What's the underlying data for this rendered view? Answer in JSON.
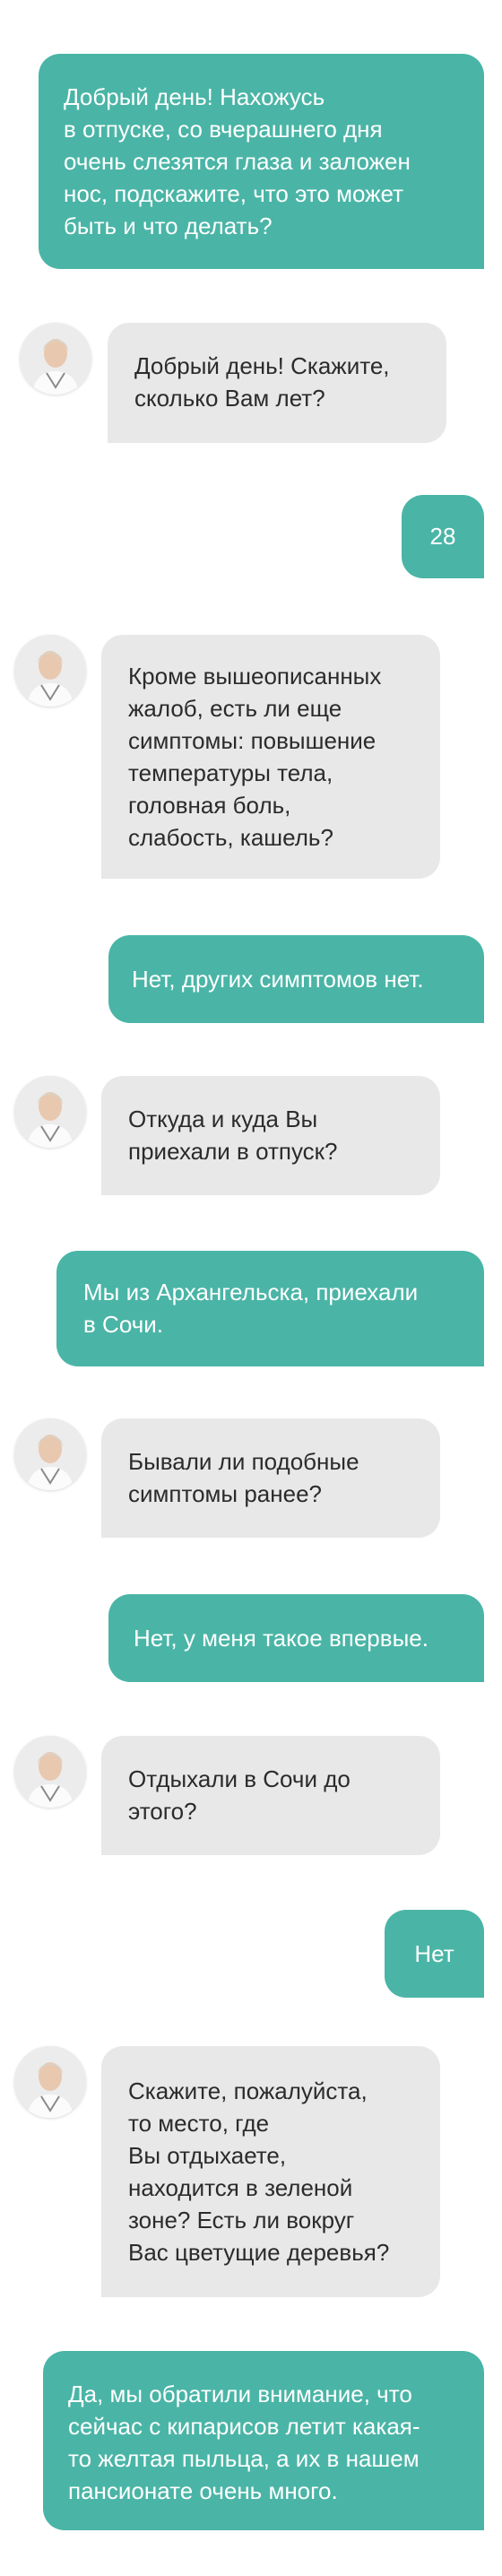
{
  "chat": {
    "messages": [
      {
        "role": "user",
        "text": "Добрый день! Нахожусь\nв отпуске, со вчерашнего дня\nочень слезятся глаза и заложен\nнос, подскажите, что это может\nбыть и что делать?"
      },
      {
        "role": "doctor",
        "text": "Добрый день! Скажите,\nсколько Вам лет?"
      },
      {
        "role": "user",
        "text": "28"
      },
      {
        "role": "doctor",
        "text": "Кроме вышеописанных\nжалоб, есть ли еще\nсимптомы: повышение\nтемпературы тела,\nголовная боль,\nслабость, кашель?"
      },
      {
        "role": "user",
        "text": "Нет, других симптомов нет."
      },
      {
        "role": "doctor",
        "text": "Откуда и куда Вы\nприехали в отпуск?"
      },
      {
        "role": "user",
        "text": "Мы из Архангельска, приехали\nв Сочи."
      },
      {
        "role": "doctor",
        "text": "Бывали ли подобные\nсимптомы ранее?"
      },
      {
        "role": "user",
        "text": "Нет, у меня такое впервые."
      },
      {
        "role": "doctor",
        "text": "Отдыхали в Сочи до\nэтого?"
      },
      {
        "role": "user",
        "text": "Нет"
      },
      {
        "role": "doctor",
        "text": "Скажите, пожалуйста,\nто место, где\nВы отдыхаете,\nнаходится в зеленой\nзоне? Есть ли вокруг\nВас цветущие деревья?"
      },
      {
        "role": "user",
        "text": "Да, мы обратили внимание, что\nсейчас с кипарисов летит какая-\nто желтая пыльца, а их в нашем\nпансионате очень много."
      }
    ]
  },
  "avatar": {
    "icon": "doctor-avatar-icon"
  },
  "colors": {
    "user_bubble": "#4ab5a6",
    "doctor_bubble": "#e8e8e8",
    "user_text": "#ffffff",
    "doctor_text": "#2b2b2b"
  }
}
